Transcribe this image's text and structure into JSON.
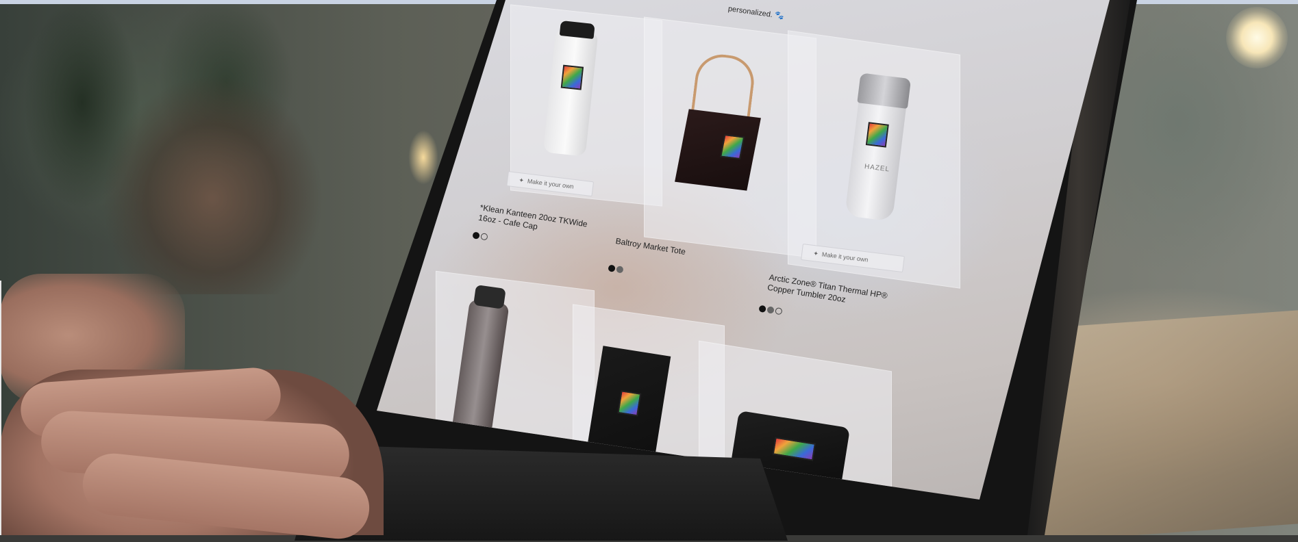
{
  "screen": {
    "header_text": "personalized.",
    "products": [
      {
        "title": "*Klean Kanteen 20oz TKWide 16oz - Cafe Cap",
        "swatches": [
          "black",
          "outline"
        ],
        "button_label": "Make it your own",
        "item_brand": ""
      },
      {
        "title": "Baltroy Market Tote",
        "swatches": [
          "black",
          "gray"
        ],
        "button_label": "",
        "item_brand": ""
      },
      {
        "title": "Arctic Zone® Titan Thermal HP® Copper Tumbler 20oz",
        "swatches": [
          "black",
          "gray",
          "outline"
        ],
        "button_label": "Make it your own",
        "item_brand": "HAZEL"
      }
    ]
  },
  "colors": {
    "swatch_black": "#111111",
    "swatch_gray": "#666666",
    "tote_handle": "#c89a6f"
  },
  "icons": {
    "personalize": "sparkle-icon",
    "header": "paw-icon"
  }
}
